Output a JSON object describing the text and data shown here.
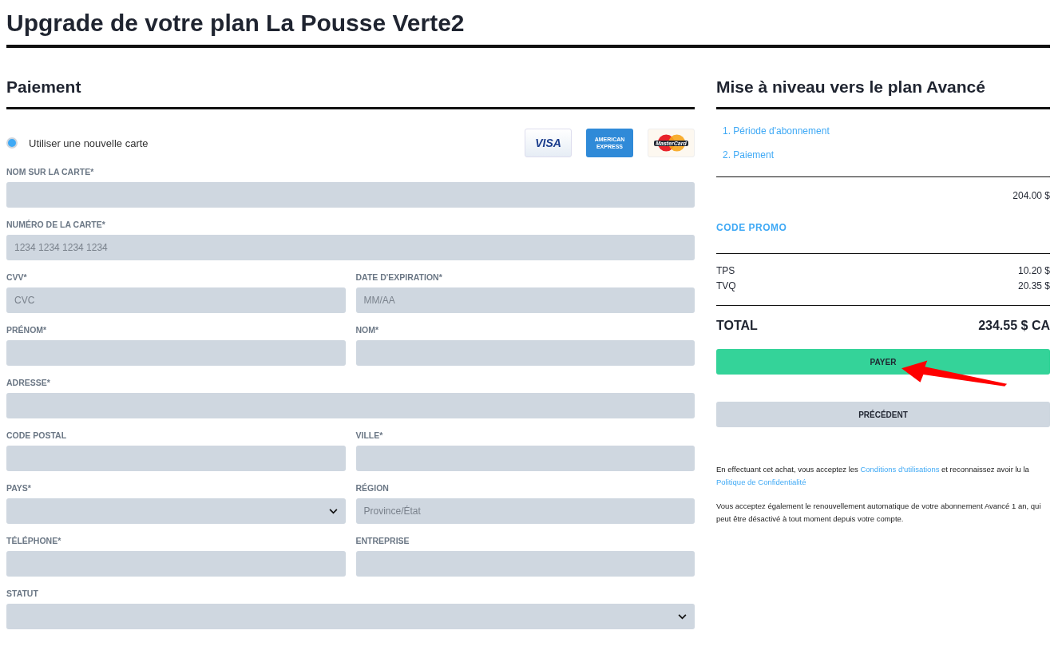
{
  "page_title": "Upgrade de votre plan La Pousse Verte2",
  "payment": {
    "heading": "Paiement",
    "card_option": {
      "label": "Utiliser une nouvelle carte",
      "selected": true
    },
    "card_brands": [
      {
        "kind": "visa",
        "text": "VISA"
      },
      {
        "kind": "amex",
        "text": "AMERICAN EXPRESS"
      },
      {
        "kind": "mastercard",
        "text": "MasterCard"
      }
    ],
    "form_rows": [
      [
        {
          "label": "NOM SUR LA CARTE*",
          "kind": "text"
        }
      ],
      [
        {
          "label": "NUMÉRO DE LA CARTE*",
          "kind": "text",
          "placeholder": "1234 1234 1234 1234"
        }
      ],
      [
        {
          "label": "CVV*",
          "kind": "text",
          "placeholder": "CVC"
        },
        {
          "label": "DATE D'EXPIRATION*",
          "kind": "text",
          "placeholder": "MM/AA"
        }
      ],
      [
        {
          "label": "PRÉNOM*",
          "kind": "text"
        },
        {
          "label": "NOM*",
          "kind": "text"
        }
      ],
      [
        {
          "label": "ADRESSE*",
          "kind": "text"
        }
      ],
      [
        {
          "label": "CODE POSTAL",
          "kind": "text"
        },
        {
          "label": "VILLE*",
          "kind": "text"
        }
      ],
      [
        {
          "label": "PAYS*",
          "kind": "select"
        },
        {
          "label": "RÉGION",
          "kind": "text",
          "placeholder": "Province/État"
        }
      ],
      [
        {
          "label": "TÉLÉPHONE*",
          "kind": "text"
        },
        {
          "label": "ENTREPRISE",
          "kind": "text"
        }
      ],
      [
        {
          "label": "STATUT",
          "kind": "select"
        }
      ]
    ]
  },
  "summary": {
    "heading": "Mise à niveau vers le plan Avancé",
    "steps": [
      "1. Période d'abonnement",
      "2. Paiement"
    ],
    "subtotal": "204.00 $",
    "promo_link": "CODE PROMO",
    "taxes": [
      {
        "name": "TPS",
        "amount": "10.20 $"
      },
      {
        "name": "TVQ",
        "amount": "20.35 $"
      }
    ],
    "total_label": "TOTAL",
    "total": "234.55 $ CA",
    "pay_button": "PAYER",
    "back_button": "PRÉCÉDENT",
    "legal": [
      {
        "before": "En effectuant cet achat, vous acceptez les ",
        "link1": "Conditions d'utilisations",
        "middle": " et reconnaissez avoir lu la ",
        "link2": "Politique de Confidentialité"
      },
      {
        "text": "Vous acceptez également le renouvellement automatique de votre abonnement Avancé 1 an, qui peut être désactivé à tout moment depuis votre compte."
      }
    ]
  }
}
